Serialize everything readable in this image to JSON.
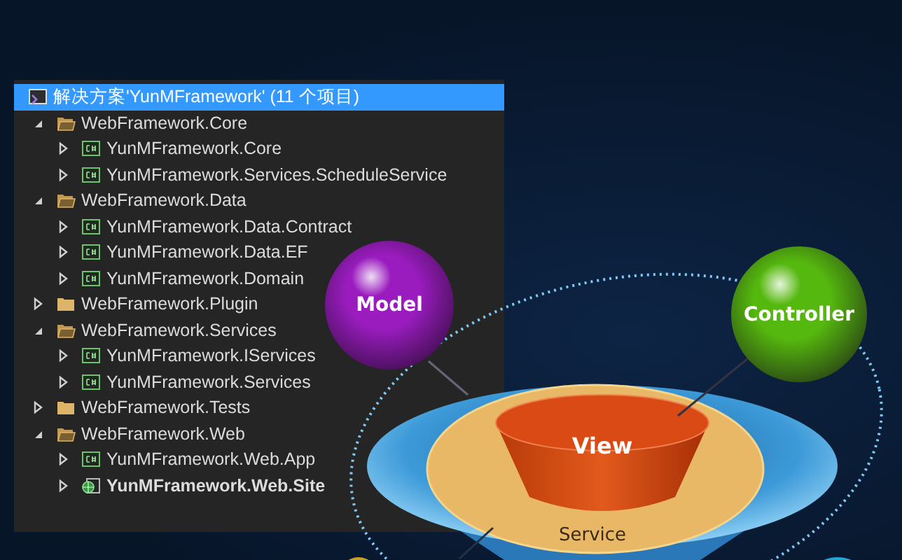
{
  "solution": {
    "label": "解决方案'YunMFramework' (11 个项目)",
    "selected": true,
    "children": [
      {
        "kind": "folder",
        "label": "WebFramework.Core",
        "expanded": true,
        "children": [
          {
            "kind": "csharp",
            "label": "YunMFramework.Core",
            "expanded": false,
            "startup": false
          },
          {
            "kind": "csharp",
            "label": "YunMFramework.Services.ScheduleService",
            "expanded": false,
            "startup": false
          }
        ]
      },
      {
        "kind": "folder",
        "label": "WebFramework.Data",
        "expanded": true,
        "children": [
          {
            "kind": "csharp",
            "label": "YunMFramework.Data.Contract",
            "expanded": false,
            "startup": false
          },
          {
            "kind": "csharp",
            "label": "YunMFramework.Data.EF",
            "expanded": false,
            "startup": false
          },
          {
            "kind": "csharp",
            "label": "YunMFramework.Domain",
            "expanded": false,
            "startup": false
          }
        ]
      },
      {
        "kind": "folder",
        "label": "WebFramework.Plugin",
        "expanded": false
      },
      {
        "kind": "folder",
        "label": "WebFramework.Services",
        "expanded": true,
        "children": [
          {
            "kind": "csharp",
            "label": "YunMFramework.IServices",
            "expanded": false,
            "startup": false
          },
          {
            "kind": "csharp",
            "label": "YunMFramework.Services",
            "expanded": false,
            "startup": false
          }
        ]
      },
      {
        "kind": "folder",
        "label": "WebFramework.Tests",
        "expanded": false
      },
      {
        "kind": "folder",
        "label": "WebFramework.Web",
        "expanded": true,
        "children": [
          {
            "kind": "csharp",
            "label": "YunMFramework.Web.App",
            "expanded": false,
            "startup": false
          },
          {
            "kind": "web",
            "label": "YunMFramework.Web.Site",
            "expanded": false,
            "startup": true
          }
        ]
      }
    ]
  },
  "diagram": {
    "model": {
      "label": "Model",
      "color": "#9a1cbf"
    },
    "controller": {
      "label": "Controller",
      "color": "#55b80e"
    },
    "view": "View",
    "service": "Service"
  }
}
